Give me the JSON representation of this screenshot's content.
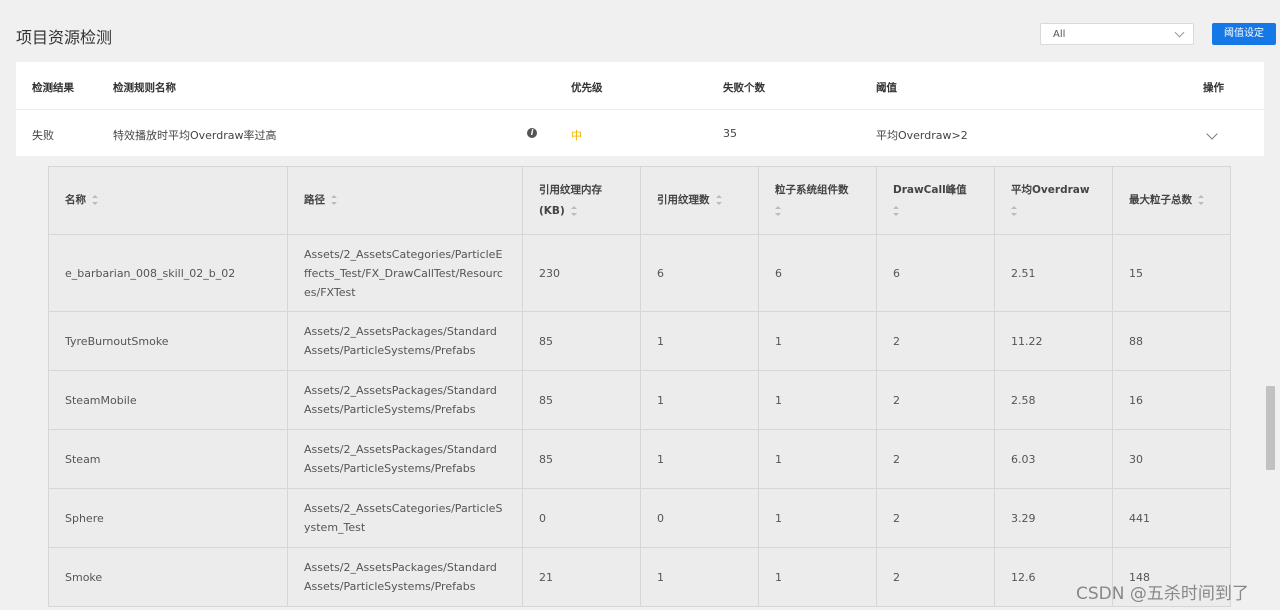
{
  "page": {
    "title": "项目资源检测"
  },
  "toolbar": {
    "filter_value": "All",
    "threshold_button": "阈值设定"
  },
  "rules_table": {
    "headers": {
      "result": "检测结果",
      "rule_name": "检测规则名称",
      "priority": "优先级",
      "fail_count": "失败个数",
      "threshold": "阈值",
      "action": "操作"
    },
    "row": {
      "result": "失败",
      "rule_name": "特效播放时平均Overdraw率过高",
      "info_glyph": "i",
      "priority": "中",
      "fail_count": "35",
      "threshold": "平均Overdraw>2"
    },
    "priority_color": "#f2b300"
  },
  "detail_table": {
    "headers": [
      "名称",
      "路径",
      "引用纹理内存(KB)",
      "引用纹理数",
      "粒子系统组件数",
      "DrawCall峰值",
      "平均Overdraw",
      "最大粒子总数"
    ],
    "rows": [
      [
        "e_barbarian_008_skill_02_b_02",
        "Assets/2_AssetsCategories/ParticleEffects_Test/FX_DrawCallTest/Resources/FXTest",
        "230",
        "6",
        "6",
        "6",
        "2.51",
        "15"
      ],
      [
        "TyreBurnoutSmoke",
        "Assets/2_AssetsPackages/Standard Assets/ParticleSystems/Prefabs",
        "85",
        "1",
        "1",
        "2",
        "11.22",
        "88"
      ],
      [
        "SteamMobile",
        "Assets/2_AssetsPackages/Standard Assets/ParticleSystems/Prefabs",
        "85",
        "1",
        "1",
        "2",
        "2.58",
        "16"
      ],
      [
        "Steam",
        "Assets/2_AssetsPackages/Standard Assets/ParticleSystems/Prefabs",
        "85",
        "1",
        "1",
        "2",
        "6.03",
        "30"
      ],
      [
        "Sphere",
        "Assets/2_AssetsCategories/ParticleSystem_Test",
        "0",
        "0",
        "1",
        "2",
        "3.29",
        "441"
      ],
      [
        "Smoke",
        "Assets/2_AssetsPackages/Standard Assets/ParticleSystems/Prefabs",
        "21",
        "1",
        "1",
        "2",
        "12.6",
        "148"
      ]
    ]
  },
  "watermark": "CSDN @五杀时间到了",
  "colors": {
    "primary": "#1677e6",
    "page_bg": "#f0f0f0",
    "table_bg": "#ececec"
  }
}
